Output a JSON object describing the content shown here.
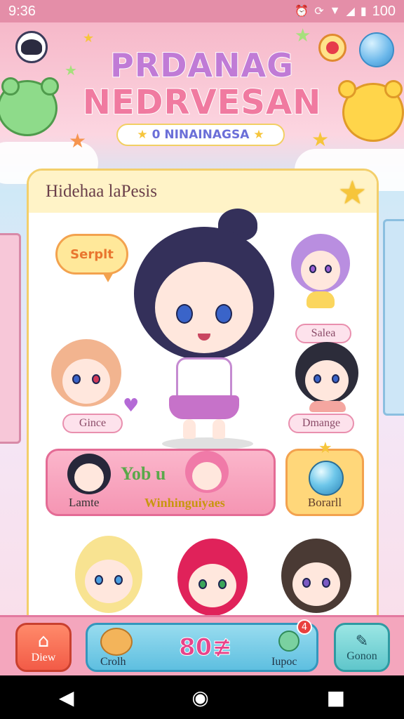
{
  "status_bar": {
    "time": "9:36",
    "battery": "100",
    "icons": [
      "alarm-icon",
      "sync-icon",
      "wifi-icon",
      "signal-icon",
      "battery-icon"
    ]
  },
  "title": {
    "line1": "PRDANAG",
    "line2": "NEDRVESAN",
    "subtitle": "0 NINAINAGSA"
  },
  "panel": {
    "header": "Hidehaa laPesis",
    "speech": "Serplt"
  },
  "characters": {
    "top_right": "Salea",
    "left": "Gince",
    "right": "Dmange"
  },
  "featured": {
    "title": "Yob u",
    "left_label": "Lamte",
    "subtitle": "Winhinguiyaes"
  },
  "orb_card": {
    "label": "Borarll"
  },
  "bottom_nav": {
    "view_label": "Diew",
    "crush_label": "Crolh",
    "coins": "80≢",
    "shop_label": "Iupoc",
    "shop_badge": "4",
    "right_label": "Gonon"
  },
  "colors": {
    "status_bar": "#e48ea8",
    "panel_border": "#f3cf6b",
    "accent_pink": "#f595b3",
    "accent_blue": "#5ebfe0"
  }
}
